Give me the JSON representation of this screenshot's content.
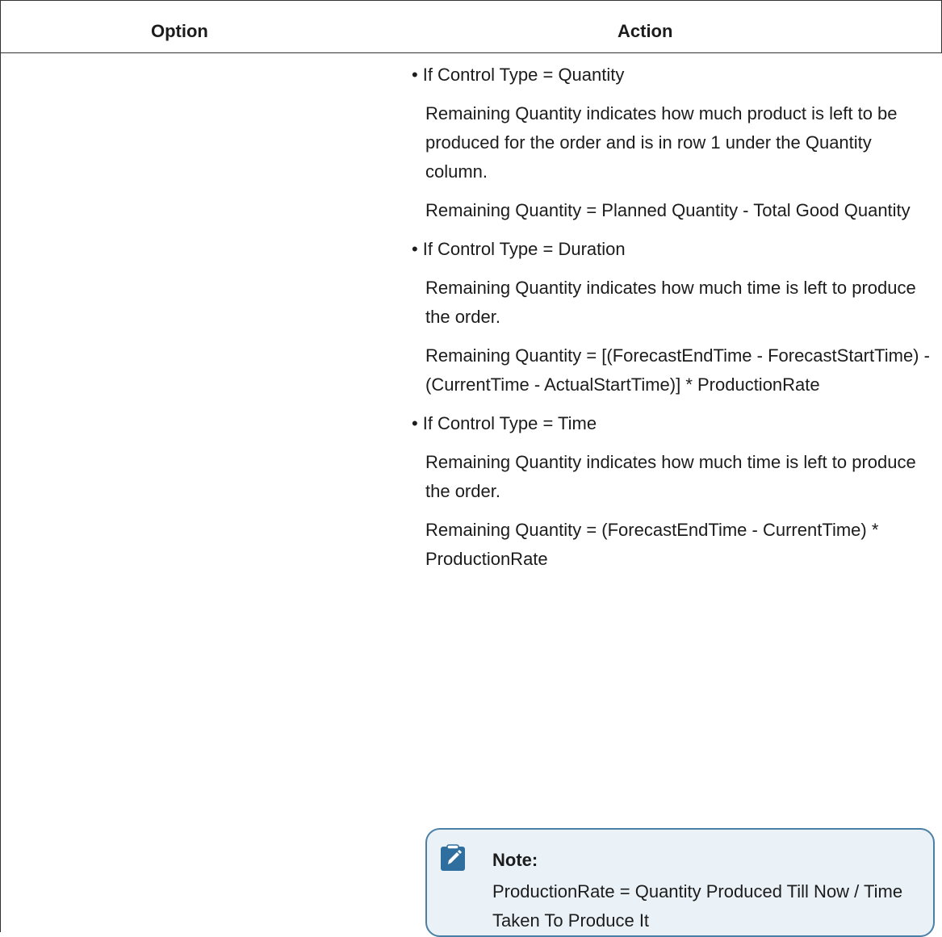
{
  "table": {
    "headers": {
      "option": "Option",
      "action": "Action"
    },
    "action": {
      "items": [
        {
          "bullet": "If Control Type = Quantity",
          "description": "Remaining Quantity indicates how much product is left to be produced for the order and is in row 1 under the Quantity column.",
          "formula": "Remaining Quantity = Planned Quantity - Total Good Quantity"
        },
        {
          "bullet": "If Control Type = Duration",
          "description": "Remaining Quantity indicates how much time is left to produce the order.",
          "formula": "Remaining Quantity = [(ForecastEndTime - ForecastStartTime) - (CurrentTime - ActualStartTime)] * ProductionRate"
        },
        {
          "bullet": "If Control Type = Time",
          "description": "Remaining Quantity indicates how much time is left to produce the order.",
          "formula": "Remaining Quantity = (ForecastEndTime - CurrentTime) * ProductionRate"
        }
      ],
      "note": {
        "title": "Note:",
        "body": "ProductionRate = Quantity Produced Till Now / Time Taken To Produce It",
        "icon": "pencil-icon",
        "accent_color": "#2f6f9f",
        "background_color": "#eaf2f8"
      }
    }
  }
}
